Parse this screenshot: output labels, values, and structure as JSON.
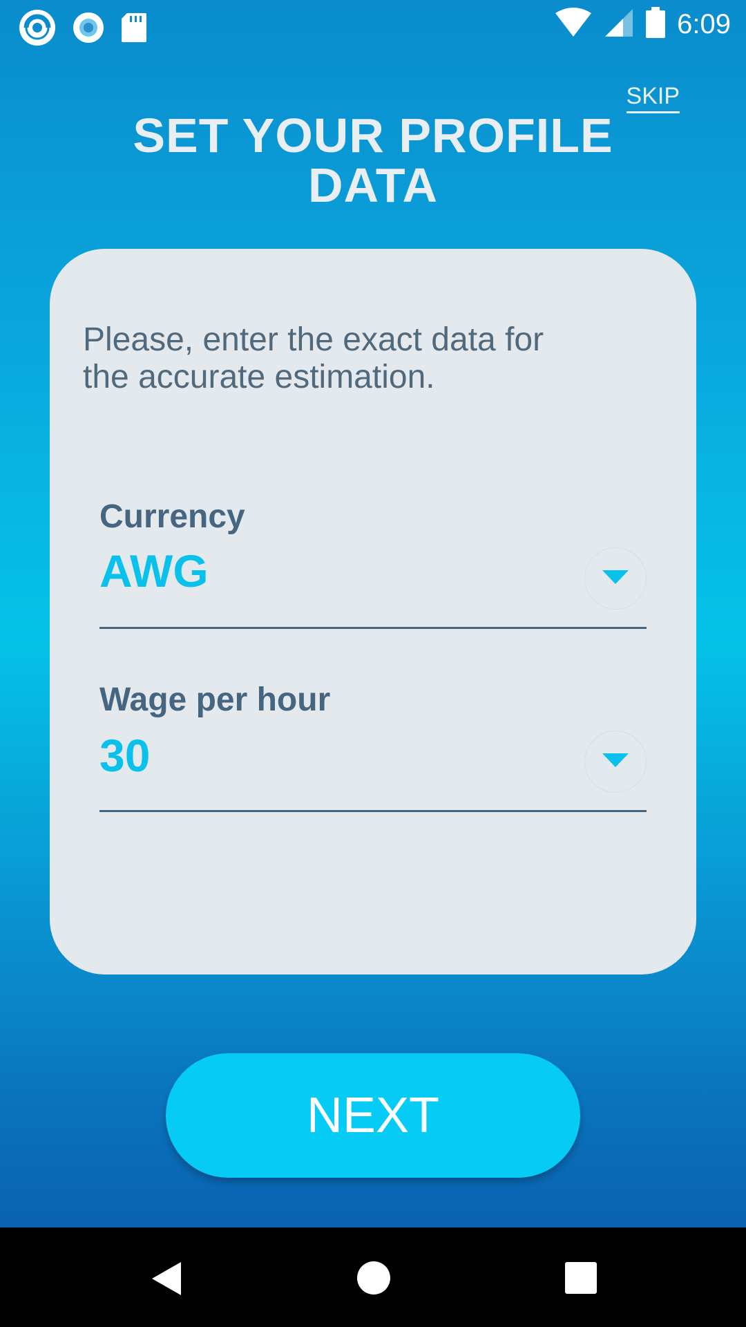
{
  "status_bar": {
    "time": "6:09",
    "left_icons": [
      "app-logo-icon",
      "record-icon",
      "sd-card-icon"
    ],
    "right_icons": [
      "wifi-icon",
      "signal-icon",
      "battery-icon"
    ]
  },
  "header": {
    "skip_label": "SKIP",
    "title_line1": "SET YOUR PROFILE",
    "title_line2": "DATA"
  },
  "card": {
    "intro_line1": "Please, enter the exact data for",
    "intro_line2": "the accurate estimation.",
    "fields": [
      {
        "label": "Currency",
        "value": "AWG"
      },
      {
        "label": "Wage per hour",
        "value": "30"
      }
    ]
  },
  "next_button": {
    "label": "NEXT"
  },
  "nav_bar": {
    "icons": [
      "back-icon",
      "home-icon",
      "recents-icon"
    ]
  },
  "colors": {
    "accent": "#06cbf5",
    "value_text": "#0ac1ec",
    "label_text": "#456580",
    "card_bg": "#e3e9ec",
    "title_text": "#e8eef2"
  }
}
